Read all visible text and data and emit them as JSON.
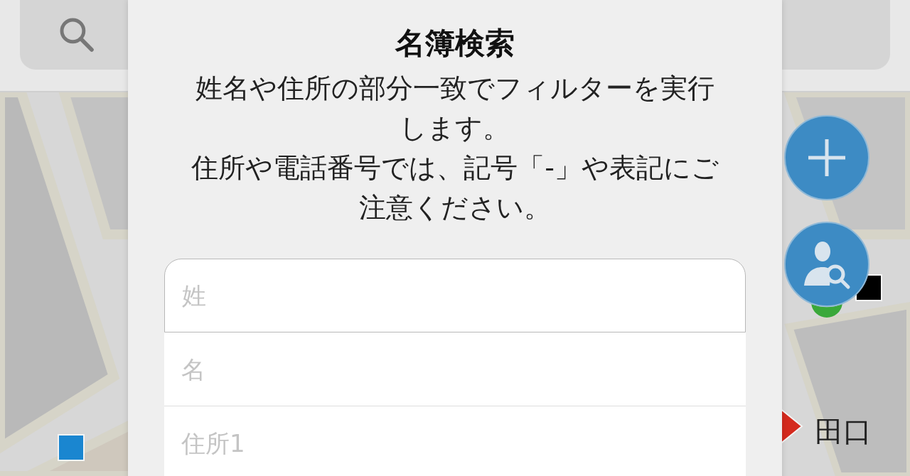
{
  "map": {
    "markers": [
      {
        "kind": "square",
        "color": "#1a86d0"
      },
      {
        "kind": "circle",
        "color": "#3aa83a"
      },
      {
        "kind": "square",
        "color": "#000000"
      },
      {
        "kind": "triangle",
        "color": "#d42a1e"
      }
    ],
    "labels": [
      {
        "text": "田口"
      }
    ]
  },
  "fab_buttons": [
    {
      "kind": "add"
    },
    {
      "kind": "person-search"
    }
  ],
  "dialog": {
    "title": "名簿検索",
    "message": [
      "姓名や住所の部分一致でフィルターを実行します。",
      "住所や電話番号では、記号「-」や表記にご注意ください。"
    ],
    "fields": [
      {
        "placeholder": "姓"
      },
      {
        "placeholder": "名"
      },
      {
        "placeholder": "住所1"
      }
    ]
  }
}
